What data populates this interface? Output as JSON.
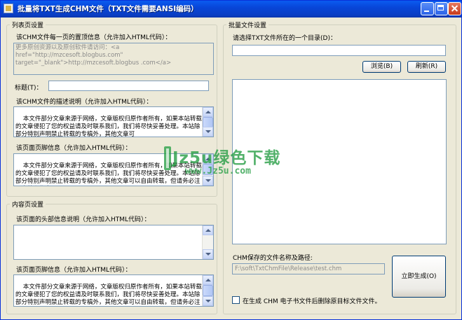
{
  "window": {
    "title": "批量将TXT生成CHM文件（TXT文件需要ANSI编码）"
  },
  "list_settings": {
    "legend": "列表页设置",
    "header_label": "该CHM文件每一页的置顶信息（允许加入HTML代码）：",
    "header_value": "更多原创资源以及原创软件请访问：<a href=\"http://mzcesoft.blogbus.com\" target=\"_blank\">http://mzcesoft.blogbus .com</a>",
    "title_label": "标题(T)：",
    "title_value": "",
    "desc_label": "该CHM文件的描述说明（允许加入HTML代码）：",
    "desc_value": "本文件部分文章来源于网络，文章版权归原作者所有，如果本站转载的文章侵犯了您的权益请及时联系我们，我们将尽快妥善处理。本站除部分特别声明禁止转载的专稿外，其他文章可",
    "footer_label": "该页面页脚信息（允许加入HTML代码）：",
    "footer_value": "本文件部分文章来源于网络，文章版权归原作者所有，如果本站转载的文章侵犯了您的权益请及时联系我们，我们将尽快妥善处理。本站除部分特别声明禁止转载的专稿外，其他文章可以自由转载，但请务必注明出处和作者。"
  },
  "content_settings": {
    "legend": "内容页设置",
    "head_label": "该页面的头部信息说明（允许加入HTML代码）：",
    "head_value": "",
    "footer_label": "该页面页脚信息（允许加入HTML代码）：",
    "footer_value": "本文件部分文章来源于网络，文章版权归原作者所有，如果本站转载的文章侵犯了您的权益请及时联系我们，我们将尽快妥善处理。本站除部分特别声明禁止转载的专稿外，其他文章可以自由转载，但请务必注明出处和作者。"
  },
  "batch_settings": {
    "legend": "批量文件设置",
    "dir_label": "请选择TXT文件所在的一个目录(D)：",
    "dir_value": "",
    "browse_button": "浏览(B)",
    "refresh_button": "刷新(R)",
    "save_label": "CHM保存的文件名称及路径:",
    "save_value": "F:\\soft\\TxtChmFile\\Release\\test.chm",
    "generate_button": "立即生成(O)",
    "delete_checkbox_label": "在生成 CHM 电子书文件后删除原目标文件文件。",
    "delete_checked": false
  },
  "watermark": {
    "line1": "Jz5u绿色下载",
    "line2": "www.Jz5u.com"
  },
  "colors": {
    "titlebar": "#0a46d8",
    "watermark": "#2da14a",
    "dialog_bg": "#ece9d8"
  }
}
